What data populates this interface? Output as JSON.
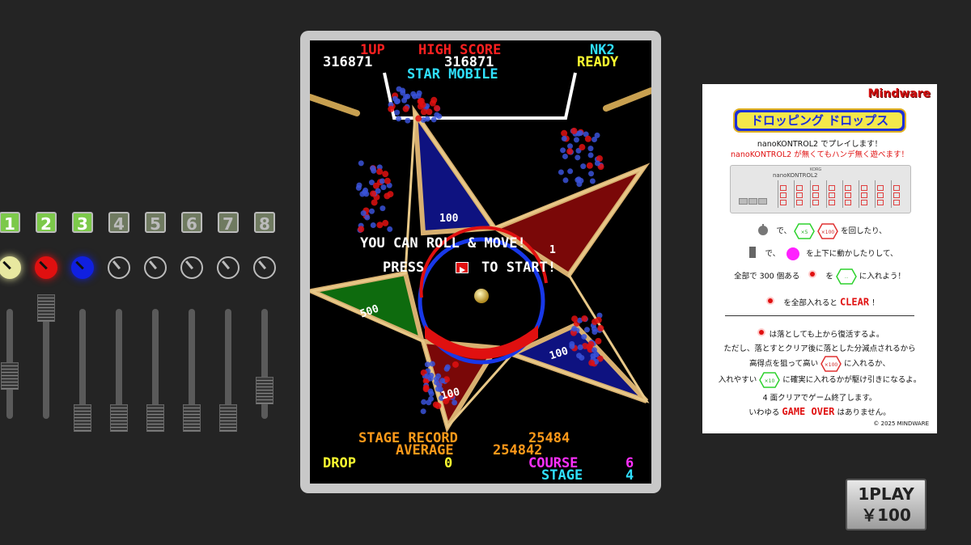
{
  "controller": {
    "channels": [
      {
        "num": "1",
        "active": true,
        "knob_color": "#e8e8a0",
        "fader_level": 0.38
      },
      {
        "num": "2",
        "active": true,
        "knob_color": "#e01010",
        "fader_level": 1.0
      },
      {
        "num": "3",
        "active": true,
        "knob_color": "#1020e0",
        "fader_level": 0.0
      },
      {
        "num": "4",
        "active": false,
        "knob_color": "#bbbbbb",
        "fader_level": 0.0
      },
      {
        "num": "5",
        "active": false,
        "knob_color": "#bbbbbb",
        "fader_level": 0.0
      },
      {
        "num": "6",
        "active": false,
        "knob_color": "#bbbbbb",
        "fader_level": 0.0
      },
      {
        "num": "7",
        "active": false,
        "knob_color": "#bbbbbb",
        "fader_level": 0.0
      },
      {
        "num": "8",
        "active": false,
        "knob_color": "#bbbbbb",
        "fader_level": 0.25
      }
    ]
  },
  "game": {
    "header": {
      "p1_label": "1UP",
      "high_label": "HIGH SCORE",
      "device_label": "NK2",
      "p1_score": "316871",
      "high_score": "316871",
      "status": "READY"
    },
    "title": "STAR MOBILE",
    "prompt_line1": "YOU CAN ROLL & MOVE!",
    "prompt_press": "PRESS",
    "prompt_to_start": "TO START!",
    "pockets": [
      "100",
      "100",
      "500",
      "100",
      "100",
      "1"
    ],
    "stage_record_label": "STAGE RECORD",
    "stage_record_value": "25484",
    "average_label": "AVERAGE",
    "average_value": "254842",
    "drop_label": "DROP",
    "drop_value": "0",
    "course_label": "COURSE",
    "course_value": "6",
    "stage_label": "STAGE",
    "stage_value": "4",
    "colors": {
      "red": "#ff2020",
      "cyan": "#30e0ff",
      "yellow": "#ffff30",
      "orange": "#ff9a1a",
      "magenta": "#ff30ff",
      "white": "#ffffff"
    }
  },
  "card": {
    "brand": "Mindware",
    "title": "ドロッピング ドロップス",
    "line1": "nanoKONTROL2 でプレイします！",
    "line2": "nanoKONTROL2 が無くてもハンデ無く遊べます！",
    "device_brand": "KORG",
    "device_name": "nanoKONTROL2",
    "i1_a": "で、",
    "i1_b": "を回したり、",
    "hex_small": "×5",
    "hex_big": "×100",
    "hex_small2": "×10",
    "hex_empty": "...",
    "i2_a": "で、",
    "i2_b": "を上下に動かしたりして、",
    "i3_a": "全部で 300 個ある",
    "i3_b": "を",
    "i3_c": "に入れよう！",
    "i4_a": "を全部入れると",
    "i4_clear": "CLEAR",
    "i4_b": "！",
    "p1": "は落としても上から復活するよ。",
    "p2": "ただし、落とすとクリア後に落とした分減点されるから",
    "p3_a": "高得点を狙って高い",
    "p3_b": "に入れるか、",
    "p4_a": "入れやすい",
    "p4_b": "に確実に入れるかが駆け引きになるよ。",
    "p5": "4 面クリアでゲーム終了します。",
    "p6_a": "いわゆる",
    "p6_go": "GAME OVER",
    "p6_b": "はありません。",
    "copyright": "© 2025 MINDWARE"
  },
  "coin": {
    "line1": "1PLAY",
    "line2": "￥100"
  }
}
